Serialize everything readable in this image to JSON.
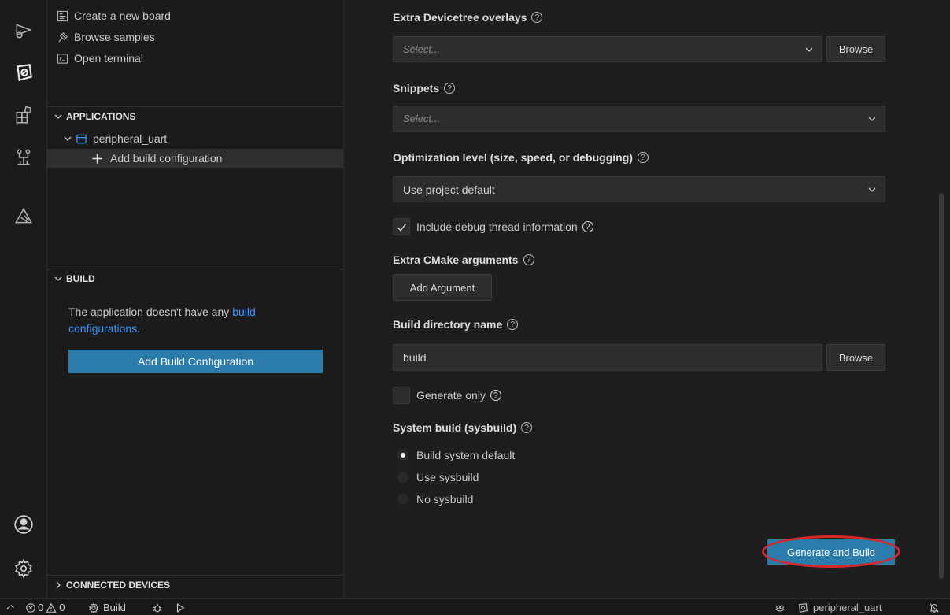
{
  "quick_actions": [
    {
      "label": "Create a new board",
      "icon": "new-board-icon"
    },
    {
      "label": "Browse samples",
      "icon": "samples-icon"
    },
    {
      "label": "Open terminal",
      "icon": "terminal-icon"
    }
  ],
  "applications": {
    "header": "APPLICATIONS",
    "app_name": "peripheral_uart",
    "add_config_label": "Add build configuration"
  },
  "build": {
    "header": "BUILD",
    "message_prefix": "The application doesn't have any ",
    "message_link": "build configurations",
    "message_suffix": ".",
    "button_label": "Add Build Configuration"
  },
  "connected_devices": {
    "header": "CONNECTED DEVICES"
  },
  "form": {
    "devicetree_overlays": {
      "label": "Extra Devicetree overlays",
      "placeholder": "Select...",
      "browse": "Browse"
    },
    "snippets": {
      "label": "Snippets",
      "placeholder": "Select..."
    },
    "optimization": {
      "label": "Optimization level (size, speed, or debugging)",
      "value": "Use project default"
    },
    "debug_thread": {
      "label": "Include debug thread information",
      "checked": true
    },
    "cmake_args": {
      "label": "Extra CMake arguments",
      "button": "Add Argument"
    },
    "build_dir": {
      "label": "Build directory name",
      "value": "build",
      "browse": "Browse"
    },
    "generate_only": {
      "label": "Generate only",
      "checked": false
    },
    "sysbuild": {
      "label": "System build (sysbuild)",
      "options": [
        "Build system default",
        "Use sysbuild",
        "No sysbuild"
      ],
      "selected": "Build system default"
    },
    "submit": "Generate and Build"
  },
  "status_bar": {
    "errors": "0",
    "warnings": "0",
    "build_label": "Build",
    "project": "peripheral_uart"
  },
  "colors": {
    "accent": "#2b7bab",
    "link": "#3794ff",
    "highlight_ring": "#d8262b"
  }
}
